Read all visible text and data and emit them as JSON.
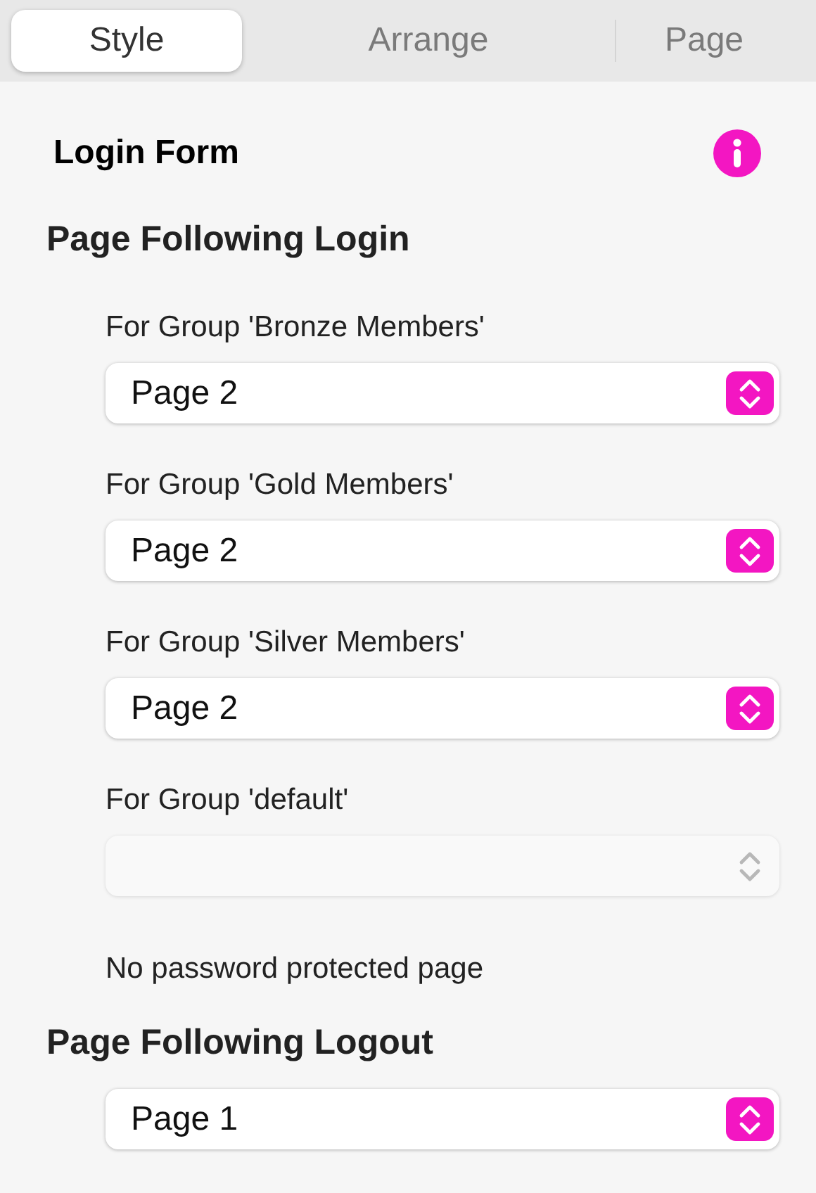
{
  "tabs": [
    {
      "label": "Style",
      "selected": true
    },
    {
      "label": "Arrange",
      "selected": false
    },
    {
      "label": "Page",
      "selected": false
    }
  ],
  "title": "Login Form",
  "sections": [
    {
      "heading": "Page Following Login",
      "items": [
        {
          "kind": "select",
          "label": "For Group 'Bronze Members'",
          "value": "Page 2",
          "disabled": false
        },
        {
          "kind": "select",
          "label": "For Group 'Gold Members'",
          "value": "Page 2",
          "disabled": false
        },
        {
          "kind": "select",
          "label": "For Group 'Silver Members'",
          "value": "Page 2",
          "disabled": false
        },
        {
          "kind": "select",
          "label": "For Group 'default'",
          "disabled": true
        },
        {
          "kind": "note",
          "text": "No password protected page"
        }
      ]
    },
    {
      "heading": "Page Following Logout",
      "items": [
        {
          "kind": "select",
          "value": "Page 1",
          "disabled": false
        }
      ]
    }
  ]
}
